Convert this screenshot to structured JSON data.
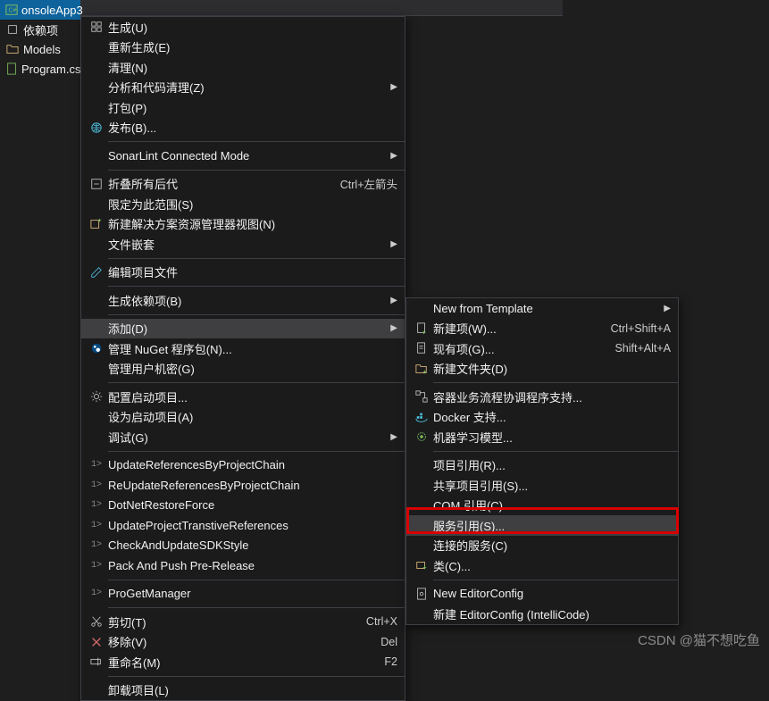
{
  "tree": {
    "project": "onsoleApp3",
    "items": [
      "依赖项",
      "Models",
      "Program.cs"
    ]
  },
  "menu": [
    {
      "icon": "build-icon",
      "label": "生成(U)"
    },
    {
      "icon": "",
      "label": "重新生成(E)"
    },
    {
      "icon": "",
      "label": "清理(N)"
    },
    {
      "icon": "",
      "label": "分析和代码清理(Z)",
      "arrow": true
    },
    {
      "icon": "",
      "label": "打包(P)"
    },
    {
      "icon": "globe-icon",
      "label": "发布(B)..."
    },
    {
      "sep": true
    },
    {
      "icon": "",
      "label": "SonarLint Connected Mode",
      "arrow": true
    },
    {
      "sep": true
    },
    {
      "icon": "collapse-icon",
      "label": "折叠所有后代",
      "shortcut": "Ctrl+左箭头"
    },
    {
      "icon": "",
      "label": "限定为此范围(S)"
    },
    {
      "icon": "new-view-icon",
      "label": "新建解决方案资源管理器视图(N)"
    },
    {
      "icon": "",
      "label": "文件嵌套",
      "arrow": true
    },
    {
      "sep": true
    },
    {
      "icon": "edit-icon",
      "label": "编辑项目文件"
    },
    {
      "sep": true
    },
    {
      "icon": "",
      "label": "生成依赖项(B)",
      "arrow": true
    },
    {
      "sep": true
    },
    {
      "icon": "",
      "label": "添加(D)",
      "arrow": true,
      "highlight": true
    },
    {
      "icon": "nuget-icon",
      "label": "管理 NuGet 程序包(N)..."
    },
    {
      "icon": "",
      "label": "管理用户机密(G)"
    },
    {
      "sep": true
    },
    {
      "icon": "gear-icon",
      "label": "配置启动项目..."
    },
    {
      "icon": "",
      "label": "设为启动项目(A)"
    },
    {
      "icon": "",
      "label": "调试(G)",
      "arrow": true
    },
    {
      "sep": true
    },
    {
      "icon": "ps",
      "label": "UpdateReferencesByProjectChain"
    },
    {
      "icon": "ps",
      "label": "ReUpdateReferencesByProjectChain"
    },
    {
      "icon": "ps",
      "label": "DotNetRestoreForce"
    },
    {
      "icon": "ps",
      "label": "UpdateProjectTranstiveReferences"
    },
    {
      "icon": "ps",
      "label": "CheckAndUpdateSDKStyle"
    },
    {
      "icon": "ps",
      "label": "Pack And Push Pre-Release"
    },
    {
      "sep": true
    },
    {
      "icon": "ps",
      "label": "ProGetManager"
    },
    {
      "sep": true
    },
    {
      "icon": "cut-icon",
      "label": "剪切(T)",
      "shortcut": "Ctrl+X"
    },
    {
      "icon": "remove-icon",
      "label": "移除(V)",
      "shortcut": "Del"
    },
    {
      "icon": "rename-icon",
      "label": "重命名(M)",
      "shortcut": "F2"
    },
    {
      "sep": true
    },
    {
      "icon": "",
      "label": "卸载项目(L)"
    }
  ],
  "submenu": [
    {
      "icon": "",
      "label": "New from Template",
      "arrow": true
    },
    {
      "icon": "new-item-icon",
      "label": "新建项(W)...",
      "shortcut": "Ctrl+Shift+A"
    },
    {
      "icon": "existing-item-icon",
      "label": "现有项(G)...",
      "shortcut": "Shift+Alt+A"
    },
    {
      "icon": "new-folder-icon",
      "label": "新建文件夹(D)"
    },
    {
      "sep": true
    },
    {
      "icon": "workflow-icon",
      "label": "容器业务流程协调程序支持..."
    },
    {
      "icon": "docker-icon",
      "label": "Docker 支持..."
    },
    {
      "icon": "ml-icon",
      "label": "机器学习模型..."
    },
    {
      "sep": true
    },
    {
      "icon": "",
      "label": "项目引用(R)..."
    },
    {
      "icon": "",
      "label": "共享项目引用(S)..."
    },
    {
      "icon": "",
      "label": "COM 引用(C)..."
    },
    {
      "icon": "",
      "label": "服务引用(S)...",
      "highlight": true
    },
    {
      "icon": "",
      "label": "连接的服务(C)"
    },
    {
      "icon": "class-icon",
      "label": "类(C)..."
    },
    {
      "sep": true
    },
    {
      "icon": "config-icon",
      "label": "New EditorConfig"
    },
    {
      "icon": "",
      "label": "新建 EditorConfig (IntelliCode)"
    }
  ],
  "watermark": "CSDN @猫不想吃鱼"
}
